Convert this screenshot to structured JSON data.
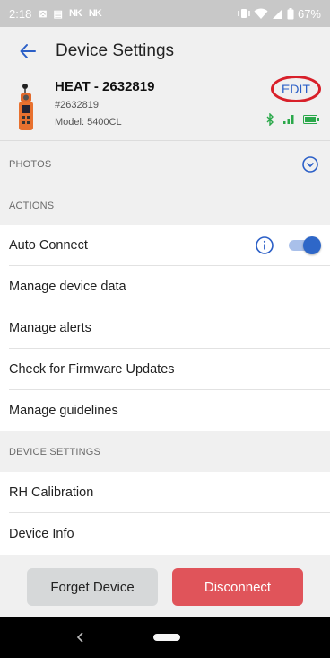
{
  "status_bar": {
    "time": "2:18",
    "notif_a": "⊠",
    "notif_b": "▤",
    "notif_c": "NK",
    "notif_d": "NK",
    "battery": "67%"
  },
  "app_bar": {
    "title": "Device Settings"
  },
  "device": {
    "name": "HEAT - 2632819",
    "serial": "#2632819",
    "model": "Model: 5400CL",
    "edit_label": "EDIT",
    "colors": {
      "edit": "#2b5fc7",
      "edit_circle": "#d8202a",
      "bluetooth": "#2aa84a",
      "battery": "#2aa84a"
    }
  },
  "sections": {
    "photos": "PHOTOS",
    "actions": "ACTIONS",
    "device_settings": "DEVICE SETTINGS"
  },
  "actions": {
    "auto_connect": "Auto Connect",
    "auto_connect_on": true,
    "manage_data": "Manage device data",
    "manage_alerts": "Manage alerts",
    "firmware": "Check for Firmware Updates",
    "guidelines": "Manage guidelines"
  },
  "device_settings": {
    "rh_calibration": "RH Calibration",
    "device_info": "Device Info"
  },
  "buttons": {
    "forget": "Forget Device",
    "disconnect": "Disconnect",
    "disconnect_color": "#e0545a"
  }
}
